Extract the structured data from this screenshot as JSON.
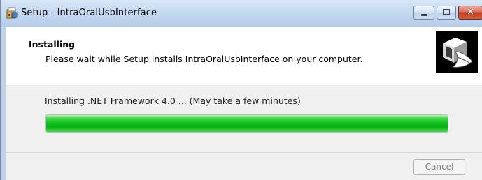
{
  "window": {
    "title": "Setup - IntraOralUsbInterface",
    "icons": {
      "app": "setup-app-icon",
      "minimize": "minimize-icon",
      "maximize": "maximize-icon",
      "close": "close-icon"
    },
    "close_glyph": "✕"
  },
  "header": {
    "title": "Installing",
    "subtitle": "Please wait while Setup installs IntraOralUsbInterface on your computer.",
    "image": "setup-wizard-image"
  },
  "status": {
    "text": "Installing .NET Framework 4.0 ... (May take a few minutes)"
  },
  "progress": {
    "value": 1.0,
    "color": "#0fbf1c"
  },
  "buttons": {
    "cancel_label": "Cancel",
    "cancel_enabled": false
  },
  "colors": {
    "titlebar": "#c5d9f1",
    "close_button": "#c23f22",
    "client_bg": "#f0f0f0"
  }
}
